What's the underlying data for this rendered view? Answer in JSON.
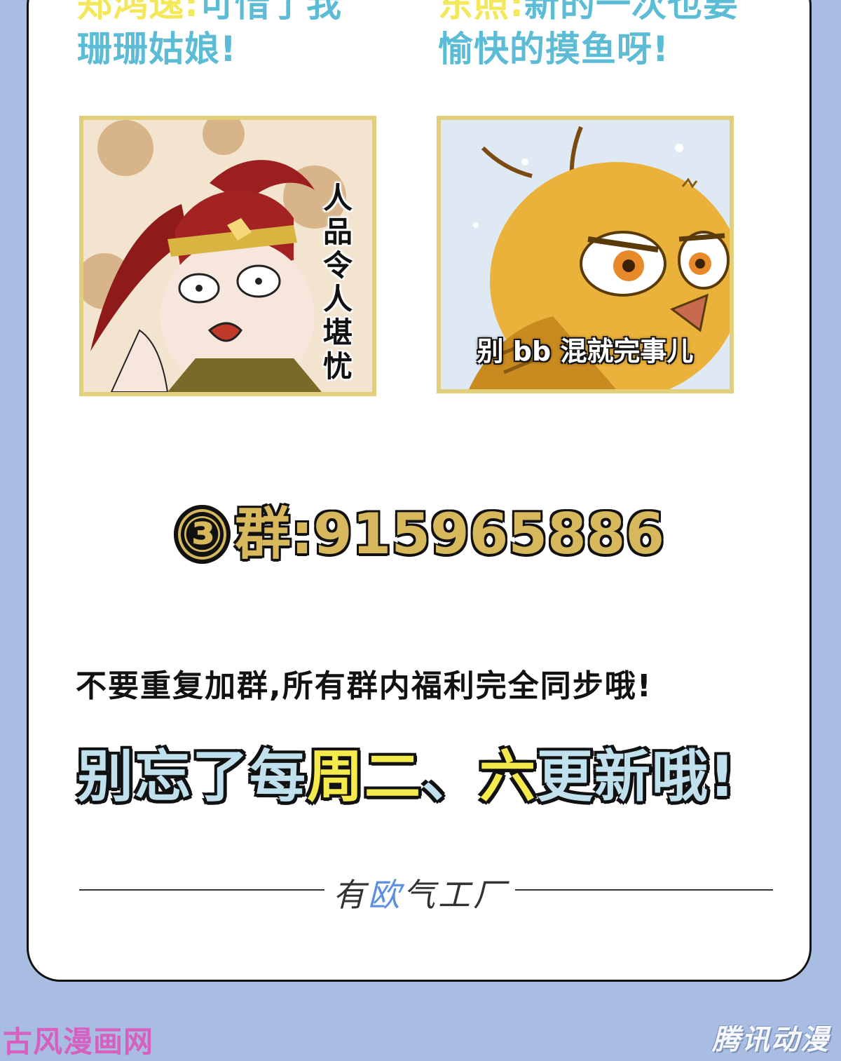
{
  "intro": {
    "left_speaker": "郑鸿逸:",
    "left_text_top": "可惜了我",
    "left_text_bottom": "珊珊姑娘!",
    "right_speaker": "东照:",
    "right_text_top": "新的一次也要",
    "right_text_bottom": "愉快的摸鱼呀!"
  },
  "panels": {
    "left_caption": "人品令人堪忧",
    "right_caption": "别 bb 混就完事儿"
  },
  "group": {
    "number_symbol": "③",
    "label": "群:",
    "id": "915965886"
  },
  "notice": "不要重复加群,所有群内福利完全同步哦!",
  "reminder": {
    "part1": "别忘了每",
    "part2": "周二",
    "part3": "、",
    "part4": "六",
    "part5": "更新哦!"
  },
  "footer": {
    "brand_a": "有",
    "brand_x": "欧",
    "brand_b": "气工厂"
  },
  "watermarks": {
    "left": "古风漫画网",
    "right": "腾讯动漫"
  },
  "colors": {
    "background": "#a9bde3",
    "intro_text": "#5cbcd6",
    "gold": "#d8b85c",
    "highlight_yellow": "#f4ea4b",
    "reminder_blue": "#bfe0ec"
  }
}
